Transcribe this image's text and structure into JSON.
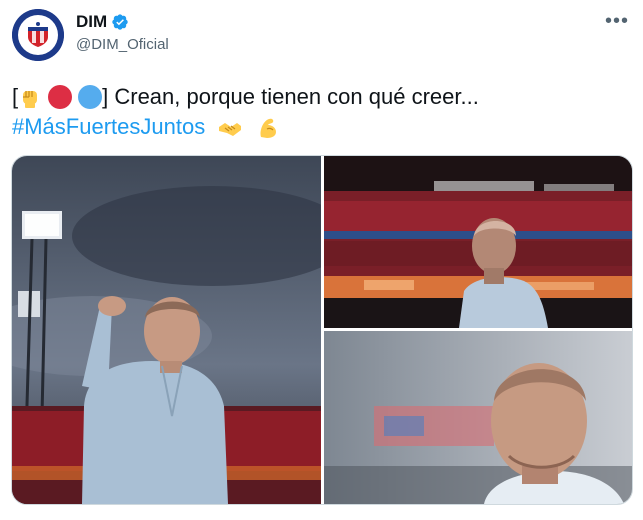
{
  "author": {
    "name": "DIM",
    "handle": "@DIM_Oficial",
    "verified": true,
    "avatar_icon": "dim-logo-icon"
  },
  "menu_icon": "more-icon",
  "tweet": {
    "open_bracket": "[",
    "close_bracket_text": "] Crean, porque tienen con qué creer...",
    "hashtag": "#MásFuertesJuntos",
    "emojis_line1": [
      "raised-fist-emoji",
      "red-circle-emoji",
      "blue-circle-emoji"
    ],
    "emojis_line2": [
      "handshake-emoji",
      "flexed-biceps-emoji"
    ]
  },
  "colors": {
    "link": "#1d9bf0",
    "verified": "#1d9bf0",
    "red_circle": "#dd2e44",
    "blue_circle": "#55acee",
    "fist": "#ffcc4d"
  },
  "media": {
    "count": 3,
    "photos": [
      {
        "name": "photo-coach-saluting"
      },
      {
        "name": "photo-coach-stadium"
      },
      {
        "name": "photo-coach-closeup"
      }
    ]
  }
}
